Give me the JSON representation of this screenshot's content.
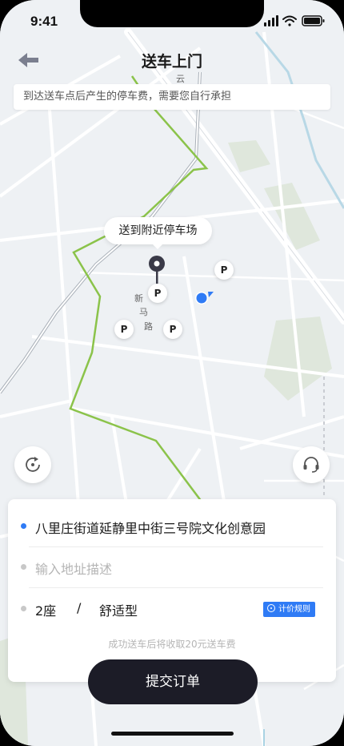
{
  "status_bar": {
    "time": "9:41"
  },
  "header": {
    "title": "送车上门"
  },
  "notice": {
    "text": "到达送车点后产生的停车费，需要您自行承担"
  },
  "map": {
    "callout": "送到附近停车场",
    "parking_label": "P",
    "road_name_chars": [
      "新",
      "马",
      "路"
    ],
    "road_label_top": "云"
  },
  "card": {
    "address": "八里庄街道延静里中街三号院文化创意园",
    "address_dot_color": "#2f7bf5",
    "desc_placeholder": "输入地址描述",
    "seat": "2座",
    "divider": "/",
    "car_type": "舒适型",
    "rule_label": "计价规则",
    "fee_note": "成功送车后将收取20元送车费"
  },
  "submit": {
    "label": "提交订单"
  },
  "colors": {
    "accent": "#2f7bf5",
    "button": "#1c1c27",
    "route": "#8bc34a"
  },
  "icons": [
    "back-arrow-icon",
    "signal-icon",
    "wifi-icon",
    "battery-icon",
    "location-pin-icon",
    "refresh-icon",
    "headset-icon",
    "info-circle-icon",
    "my-location-icon"
  ]
}
